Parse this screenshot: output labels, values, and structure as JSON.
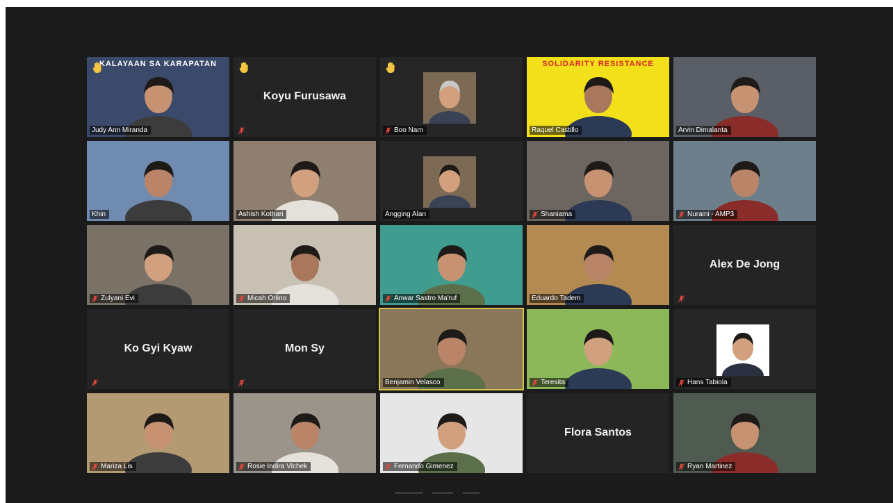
{
  "meeting": {
    "title": "Zoom gallery view"
  },
  "colors": {
    "frame_bg": "#1b1b1b",
    "tile_bg": "#262626",
    "active_speaker_border": "#d8c64a",
    "muted_icon": "#e0473c",
    "raised_hand": "#f5c542"
  },
  "participants": [
    {
      "name": "Judy Ann Miranda",
      "video": true,
      "hand_raised": true,
      "muted": false,
      "bg": "#3b4a6b",
      "sign": "KALAYAAN SA KARAPATAN"
    },
    {
      "name": "Koyu Furusawa",
      "video": false,
      "hand_raised": true,
      "muted": true
    },
    {
      "name": "Boo Nam",
      "video": true,
      "thumb": true,
      "hand_raised": true,
      "muted": true,
      "bg": "#262626"
    },
    {
      "name": "Raquel Castillo",
      "video": true,
      "hand_raised": false,
      "muted": false,
      "bg": "#f2e01a",
      "sign": "SOLIDARITY RESISTANCE"
    },
    {
      "name": "Arvin Dimalanta",
      "video": true,
      "hand_raised": false,
      "muted": false,
      "bg": "#5a5e66"
    },
    {
      "name": "Khin",
      "video": true,
      "hand_raised": false,
      "muted": false,
      "bg": "#6f8bb0"
    },
    {
      "name": "Ashish Kothari",
      "video": true,
      "hand_raised": false,
      "muted": false,
      "bg": "#8e7f70"
    },
    {
      "name": "Angging Alan",
      "video": true,
      "thumb": true,
      "hand_raised": false,
      "muted": false,
      "bg": "#262626"
    },
    {
      "name": "Shaniama",
      "video": true,
      "hand_raised": false,
      "muted": true,
      "bg": "#6d6660"
    },
    {
      "name": "Nuraini - AMP3",
      "video": true,
      "hand_raised": false,
      "muted": true,
      "bg": "#6d7f8a"
    },
    {
      "name": "Zulyani Evi",
      "video": true,
      "hand_raised": false,
      "muted": true,
      "bg": "#7a7266"
    },
    {
      "name": "Micah Orlino",
      "video": true,
      "hand_raised": false,
      "muted": true,
      "bg": "#c9c0b4"
    },
    {
      "name": "Anwar Sastro Ma'ruf",
      "video": true,
      "hand_raised": false,
      "muted": true,
      "bg": "#3f9c8f"
    },
    {
      "name": "Eduardo Tadem",
      "video": true,
      "hand_raised": false,
      "muted": false,
      "bg": "#b38a52"
    },
    {
      "name": "Alex De Jong",
      "video": false,
      "hand_raised": false,
      "muted": true
    },
    {
      "name": "Ko Gyi Kyaw",
      "video": false,
      "hand_raised": false,
      "muted": true
    },
    {
      "name": "Mon Sy",
      "video": false,
      "hand_raised": false,
      "muted": true
    },
    {
      "name": "Benjamin Velasco",
      "video": true,
      "hand_raised": false,
      "muted": false,
      "active": true,
      "bg": "#8a7658"
    },
    {
      "name": "Teresita",
      "video": true,
      "hand_raised": false,
      "muted": true,
      "bg": "#8cb85a"
    },
    {
      "name": "Hans Tabiola",
      "video": true,
      "thumb": true,
      "hand_raised": false,
      "muted": true,
      "bg": "#262626"
    },
    {
      "name": "Mariza Lis",
      "video": true,
      "hand_raised": false,
      "muted": true,
      "bg": "#b49a72"
    },
    {
      "name": "Rosie Indira Vlchek",
      "video": true,
      "hand_raised": false,
      "muted": true,
      "bg": "#9a948a"
    },
    {
      "name": "Fernando Gimenez",
      "video": true,
      "hand_raised": false,
      "muted": true,
      "bg": "#e6e6e6"
    },
    {
      "name": "Flora Santos",
      "video": false,
      "hand_raised": false,
      "muted": false
    },
    {
      "name": "Ryan Martinez",
      "video": true,
      "hand_raised": false,
      "muted": true,
      "bg": "#4f5b50"
    }
  ]
}
